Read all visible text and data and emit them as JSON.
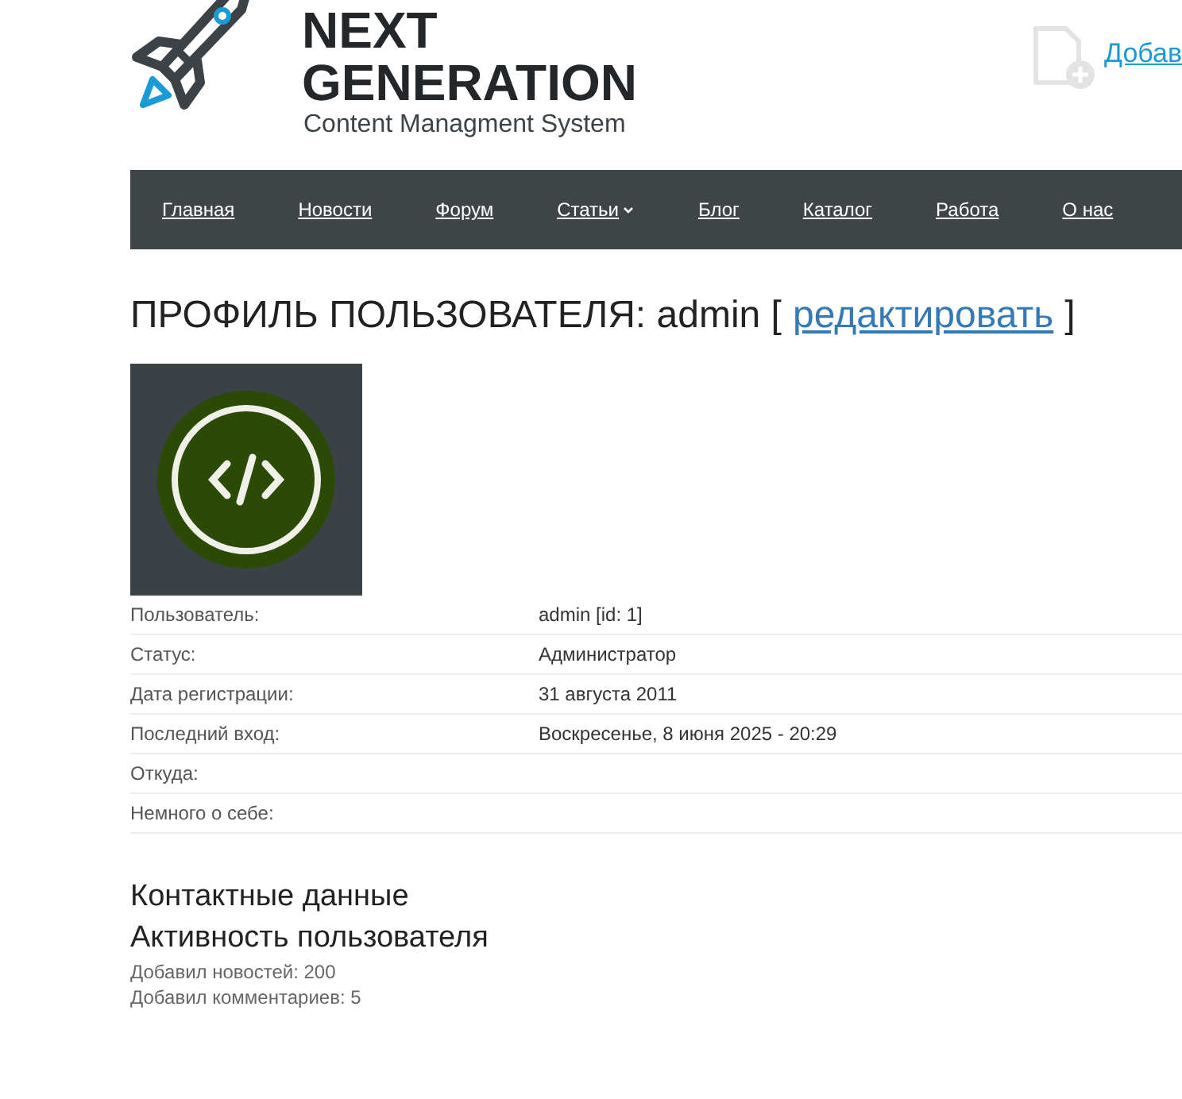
{
  "logo": {
    "line1": "NEXT",
    "line2": "GENERATION",
    "tagline": "Content Managment System"
  },
  "header_link": "Добав",
  "nav": [
    {
      "label": "Главная",
      "has_dropdown": false
    },
    {
      "label": "Новости",
      "has_dropdown": false
    },
    {
      "label": "Форум",
      "has_dropdown": false
    },
    {
      "label": "Статьи",
      "has_dropdown": true
    },
    {
      "label": "Блог",
      "has_dropdown": false
    },
    {
      "label": "Каталог",
      "has_dropdown": false
    },
    {
      "label": "Работа",
      "has_dropdown": false
    },
    {
      "label": "О нас",
      "has_dropdown": false
    }
  ],
  "title": {
    "prefix": "ПРОФИЛЬ ПОЛЬЗОВАТЕЛЯ: admin [",
    "edit_link": "редактировать",
    "suffix": "]"
  },
  "profile": [
    {
      "label": "Пользователь:",
      "value": "admin [id: 1]"
    },
    {
      "label": "Статус:",
      "value": "Администратор"
    },
    {
      "label": "Дата регистрации:",
      "value": "31 августа 2011"
    },
    {
      "label": "Последний вход:",
      "value": "Воскресенье, 8 июня 2025 - 20:29"
    },
    {
      "label": "Откуда:"
    },
    {
      "label": "Немного о себе:"
    }
  ],
  "contacts_heading": "Контактные данные",
  "activity_heading": "Активность пользователя",
  "activity": [
    "Добавил новостей: 200",
    "Добавил комментариев: 5"
  ]
}
